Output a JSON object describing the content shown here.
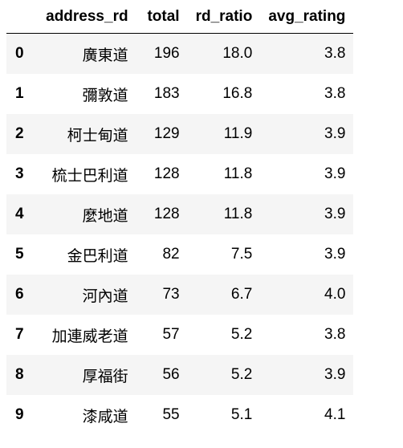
{
  "table": {
    "columns": [
      "address_rd",
      "total",
      "rd_ratio",
      "avg_rating"
    ],
    "rows": [
      {
        "index": "0",
        "address_rd": "廣東道",
        "total": "196",
        "rd_ratio": "18.0",
        "avg_rating": "3.8"
      },
      {
        "index": "1",
        "address_rd": "彌敦道",
        "total": "183",
        "rd_ratio": "16.8",
        "avg_rating": "3.8"
      },
      {
        "index": "2",
        "address_rd": "柯士甸道",
        "total": "129",
        "rd_ratio": "11.9",
        "avg_rating": "3.9"
      },
      {
        "index": "3",
        "address_rd": "梳士巴利道",
        "total": "128",
        "rd_ratio": "11.8",
        "avg_rating": "3.9"
      },
      {
        "index": "4",
        "address_rd": "麼地道",
        "total": "128",
        "rd_ratio": "11.8",
        "avg_rating": "3.9"
      },
      {
        "index": "5",
        "address_rd": "金巴利道",
        "total": "82",
        "rd_ratio": "7.5",
        "avg_rating": "3.9"
      },
      {
        "index": "6",
        "address_rd": "河內道",
        "total": "73",
        "rd_ratio": "6.7",
        "avg_rating": "4.0"
      },
      {
        "index": "7",
        "address_rd": "加連威老道",
        "total": "57",
        "rd_ratio": "5.2",
        "avg_rating": "3.8"
      },
      {
        "index": "8",
        "address_rd": "厚福街",
        "total": "56",
        "rd_ratio": "5.2",
        "avg_rating": "3.9"
      },
      {
        "index": "9",
        "address_rd": "漆咸道",
        "total": "55",
        "rd_ratio": "5.1",
        "avg_rating": "4.1"
      }
    ]
  }
}
